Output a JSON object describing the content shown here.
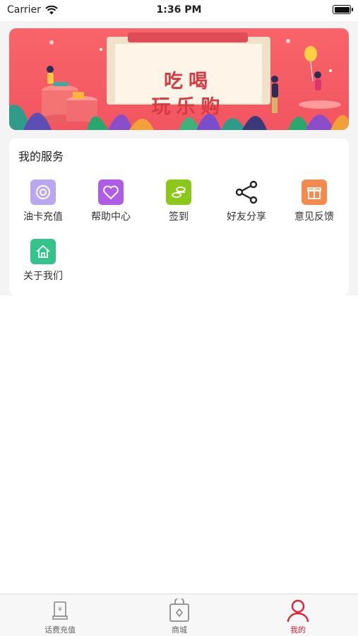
{
  "status_bar": {
    "carrier": "Carrier",
    "time": "1:36 PM"
  },
  "banner": {
    "line1": "吃喝",
    "line2": "玩乐购"
  },
  "services": {
    "title": "我的服务",
    "items": [
      {
        "label": "油卡充值",
        "icon": "fuel-card-icon",
        "color": "#b9a7f2"
      },
      {
        "label": "帮助中心",
        "icon": "heart-icon",
        "color": "#b05ce6"
      },
      {
        "label": "签到",
        "icon": "coins-icon",
        "color": "#8bc81a"
      },
      {
        "label": "好友分享",
        "icon": "share-icon",
        "color": "#222222"
      },
      {
        "label": "意见反馈",
        "icon": "gift-icon",
        "color": "#f58a4e"
      },
      {
        "label": "关于我们",
        "icon": "home-icon",
        "color": "#34c48b"
      }
    ]
  },
  "tabbar": {
    "items": [
      {
        "label": "话费充值",
        "icon": "phone-bill-icon",
        "active": false
      },
      {
        "label": "商城",
        "icon": "shopping-bag-icon",
        "active": false
      },
      {
        "label": "我的",
        "icon": "user-icon",
        "active": true
      }
    ],
    "active_color": "#e0243a"
  }
}
